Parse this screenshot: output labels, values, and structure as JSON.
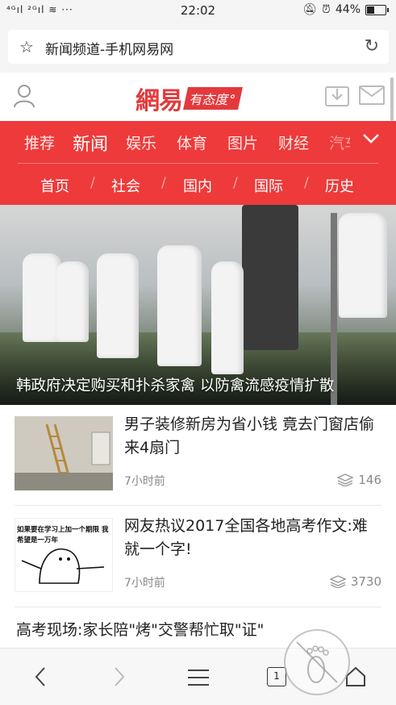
{
  "status_bar": {
    "signal": "⁴ᴳıl ²ᴳıl",
    "wifi_icon": "wifi-icon",
    "dots": "···",
    "time": "22:02",
    "battery_percent": "44%",
    "battery_level": 0.44
  },
  "url_bar": {
    "title": "新闻频道-手机网易网"
  },
  "header": {
    "brand": "網易",
    "tagline": "有态度°"
  },
  "nav": {
    "tabs": [
      {
        "label": "推荐"
      },
      {
        "label": "新闻"
      },
      {
        "label": "娱乐"
      },
      {
        "label": "体育"
      },
      {
        "label": "图片"
      },
      {
        "label": "财经"
      },
      {
        "label": "汽车"
      }
    ],
    "subtabs": [
      {
        "label": "首页"
      },
      {
        "label": "社会"
      },
      {
        "label": "国内"
      },
      {
        "label": "国际"
      },
      {
        "label": "历史"
      }
    ],
    "separator": "/"
  },
  "hero": {
    "headline": "韩政府决定购买和扑杀家禽 以防禽流感疫情扩散"
  },
  "news": [
    {
      "title": "男子装修新房为省小钱 竟去门窗店偷来4扇门",
      "time": "7小时前",
      "comments": "146"
    },
    {
      "title": "网友热议2017全国各地高考作文:难就一个字!",
      "time": "7小时前",
      "comments": "3730",
      "thumb_text": "如果要在学习上加一个期限 我希望是一万年"
    },
    {
      "title": "高考现场:家长陪\"烤\"交警帮忙取\"证\""
    }
  ],
  "bottom_bar": {
    "tab_count": "1"
  },
  "colors": {
    "brand_red": "#ee3a3a"
  }
}
